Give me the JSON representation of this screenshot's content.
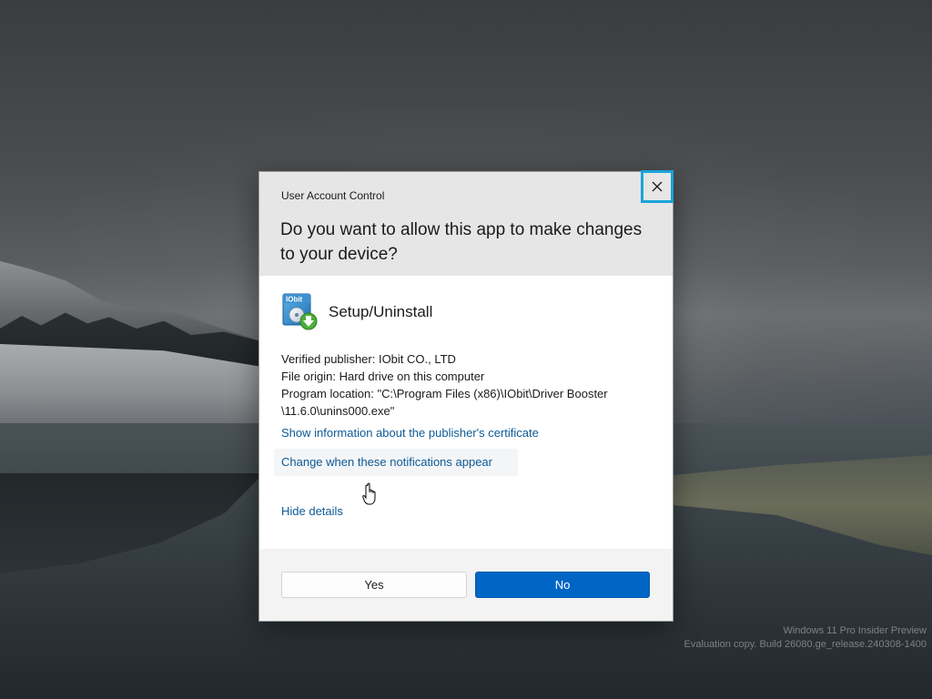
{
  "dialog": {
    "title": "User Account Control",
    "question": "Do you want to allow this app to make changes to your device?",
    "app_name": "Setup/Uninstall",
    "app_icon_text": "IObit",
    "details": {
      "publisher": "Verified publisher: IObit CO., LTD",
      "origin": "File origin: Hard drive on this computer",
      "location_line1": "Program location: \"C:\\Program Files (x86)\\IObit\\Driver Booster",
      "location_line2": "\\11.6.0\\unins000.exe\""
    },
    "links": {
      "certificate": "Show information about the publisher's certificate",
      "notifications": "Change when these notifications appear",
      "hide_details": "Hide details"
    },
    "buttons": {
      "yes": "Yes",
      "no": "No"
    },
    "close_icon": "close-icon",
    "accent_color": "#0066c6",
    "focus_color": "#1aa3d9",
    "link_color": "#0e5a96"
  },
  "watermark": {
    "line1": "Windows 11 Pro Insider Preview",
    "line2": "Evaluation copy. Build 26080.ge_release.240308-1400"
  }
}
